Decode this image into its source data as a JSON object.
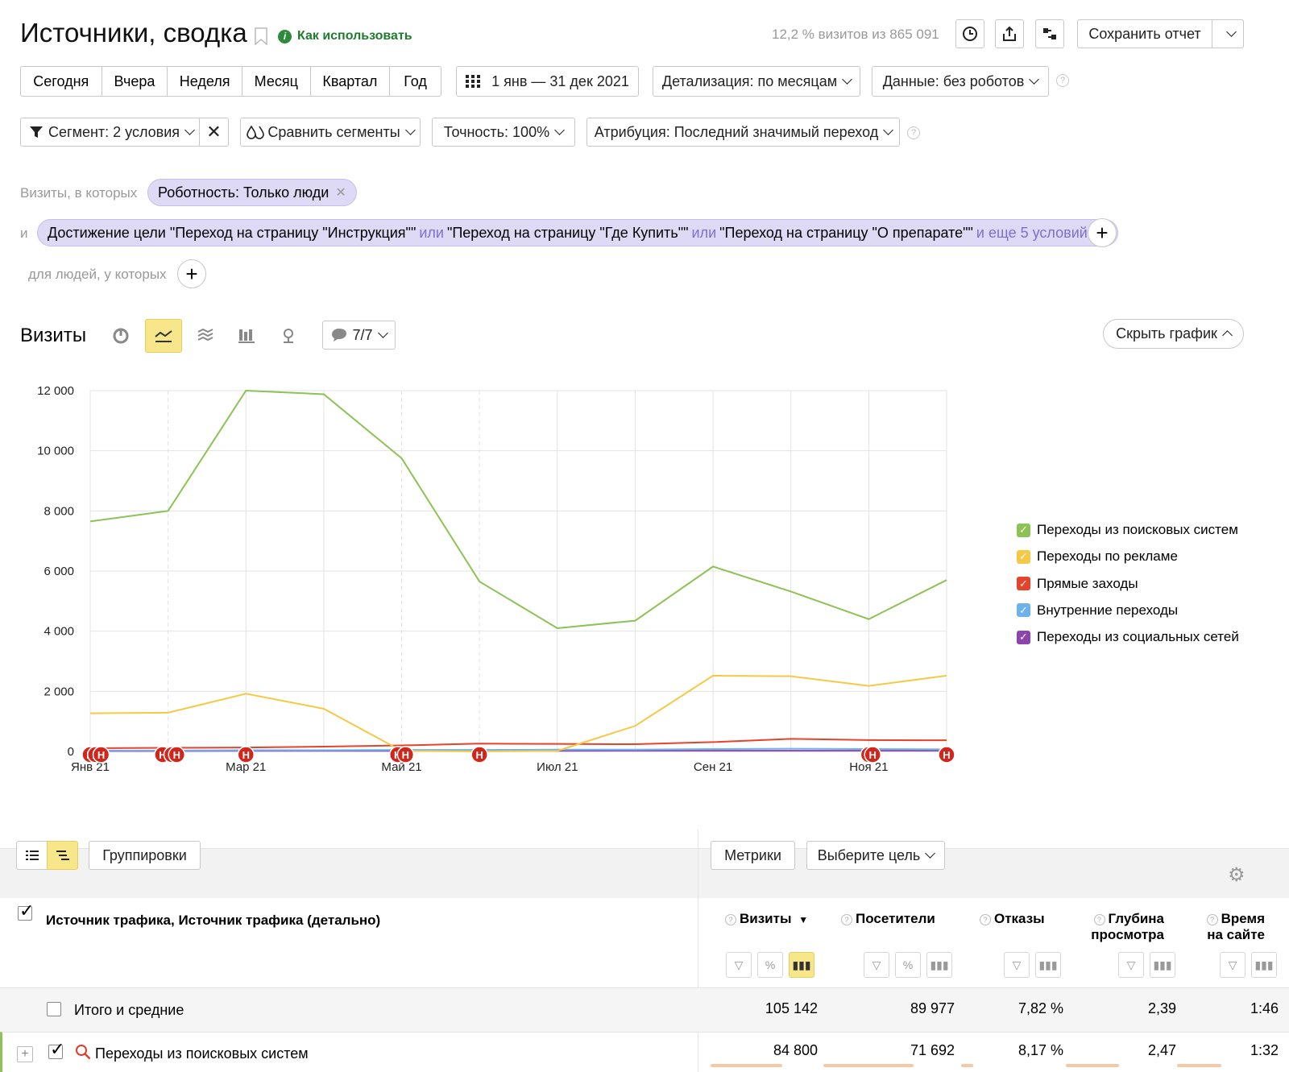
{
  "header": {
    "title": "Источники, сводка",
    "how_to": "Как использовать",
    "visits_share": "12,2 % визитов из 865 091",
    "save_label": "Сохранить отчет"
  },
  "period_tabs": [
    "Сегодня",
    "Вчера",
    "Неделя",
    "Месяц",
    "Квартал",
    "Год"
  ],
  "date_range": "1 янв — 31 дек 2021",
  "detail": "Детализация: по месяцам",
  "data_filter": "Данные: без роботов",
  "segment": "Сегмент: 2 условия",
  "compare": "Сравнить сегменты",
  "accuracy": "Точность: 100%",
  "attribution": "Атрибуция: Последний значимый переход",
  "conditions": {
    "visits_label": "Визиты, в которых",
    "robot_chip": "Роботность: Только люди",
    "and_label": "и",
    "goal_prefix": "Достижение цели \"Переход на страницу \"Инструкция\"\"",
    "or1": "или",
    "goal_mid": "\"Переход на страницу \"Где Купить\"\"",
    "or2": "или",
    "goal_end": "\"Переход на страницу \"О препарате\"\"",
    "more": "и еще 5 условий",
    "people_label": "для людей, у которых"
  },
  "chart_section": {
    "title": "Визиты",
    "notes_counter": "7/7",
    "hide_label": "Скрыть график"
  },
  "chart_data": {
    "type": "line",
    "x": [
      "Янв 21",
      "Фев 21",
      "Мар 21",
      "Апр 21",
      "Май 21",
      "Июн 21",
      "Июл 21",
      "Авг 21",
      "Сен 21",
      "Окт 21",
      "Ноя 21",
      "Дек 21"
    ],
    "x_tick_labels": [
      "Янв 21",
      "Мар 21",
      "Май 21",
      "Июл 21",
      "Сен 21",
      "Ноя 21"
    ],
    "y_tick_labels": [
      "0",
      "2 000",
      "4 000",
      "6 000",
      "8 000",
      "10 000",
      "12 000"
    ],
    "ylim": [
      0,
      12000
    ],
    "grid": true,
    "legend_position": "right",
    "series": [
      {
        "name": "Переходы из поисковых систем",
        "color": "#8dc254",
        "values": [
          7650,
          8000,
          12000,
          11880,
          9750,
          5650,
          4100,
          4350,
          6150,
          5320,
          4400,
          5700
        ]
      },
      {
        "name": "Переходы по рекламе",
        "color": "#f6c944",
        "values": [
          1270,
          1290,
          1920,
          1420,
          20,
          0,
          20,
          850,
          2520,
          2500,
          2180,
          2520
        ]
      },
      {
        "name": "Прямые заходы",
        "color": "#e5432a",
        "values": [
          110,
          120,
          130,
          160,
          200,
          260,
          250,
          240,
          310,
          420,
          380,
          370
        ]
      },
      {
        "name": "Внутренние переходы",
        "color": "#6cb2ee",
        "values": [
          30,
          30,
          40,
          40,
          50,
          50,
          60,
          60,
          80,
          90,
          80,
          70
        ]
      },
      {
        "name": "Переходы из социальных сетей",
        "color": "#8e44ad",
        "values": [
          15,
          15,
          20,
          20,
          20,
          20,
          20,
          25,
          25,
          25,
          25,
          25
        ]
      }
    ],
    "note_marker_label": "Н"
  },
  "table": {
    "groupings": "Группировки",
    "metrics_btn": "Метрики",
    "goal_select": "Выберите цель",
    "dimension_header": "Источник трафика, Источник трафика (детально)",
    "columns": [
      {
        "label_1": "Визиты",
        "label_2": "",
        "sort": "▼"
      },
      {
        "label_1": "Посетители",
        "label_2": ""
      },
      {
        "label_1": "Отказы",
        "label_2": ""
      },
      {
        "label_1": "Глубина",
        "label_2": "просмотра"
      },
      {
        "label_1": "Время",
        "label_2": "на сайте"
      }
    ],
    "totals": {
      "label": "Итого и средние",
      "values": [
        "105 142",
        "89 977",
        "7,82 %",
        "2,39",
        "1:46"
      ]
    },
    "rows": [
      {
        "label": "Переходы из поисковых систем",
        "values": [
          "84 800",
          "71 692",
          "8,17 %",
          "2,47",
          "1:32"
        ],
        "bar_fractions": [
          0.81,
          0.8,
          0.15,
          0.6,
          0.5
        ]
      }
    ]
  }
}
